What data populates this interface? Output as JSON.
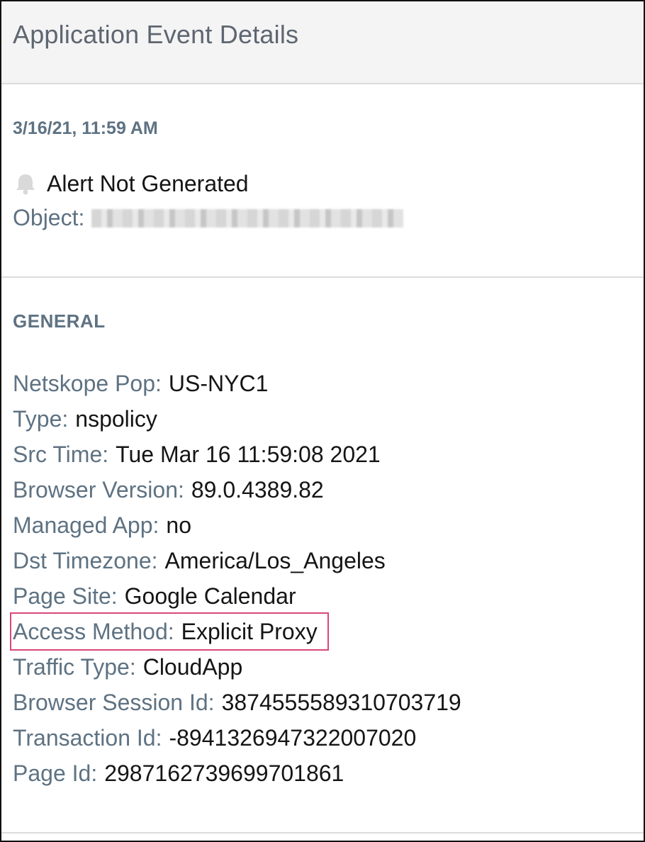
{
  "header": {
    "title": "Application Event Details"
  },
  "event": {
    "timestamp": "3/16/21, 11:59 AM",
    "alert_status": "Alert Not Generated",
    "alert_icon": "bell-icon",
    "object_label": "Object:"
  },
  "general": {
    "heading": "GENERAL",
    "fields": [
      {
        "label": "Netskope Pop:",
        "value": "US-NYC1"
      },
      {
        "label": "Type:",
        "value": "nspolicy"
      },
      {
        "label": "Src Time:",
        "value": "Tue Mar 16 11:59:08 2021"
      },
      {
        "label": "Browser Version:",
        "value": "89.0.4389.82"
      },
      {
        "label": "Managed App:",
        "value": "no"
      },
      {
        "label": "Dst Timezone:",
        "value": "America/Los_Angeles"
      },
      {
        "label": "Page Site:",
        "value": "Google Calendar"
      },
      {
        "label": "Access Method:",
        "value": "Explicit Proxy",
        "highlighted": true
      },
      {
        "label": "Traffic Type:",
        "value": "CloudApp"
      },
      {
        "label": "Browser Session Id:",
        "value": "3874555589310703719"
      },
      {
        "label": "Transaction Id:",
        "value": "-8941326947322007020"
      },
      {
        "label": "Page Id:",
        "value": "2987162739699701861"
      }
    ]
  },
  "colors": {
    "label": "#5e7282",
    "value": "#151515",
    "highlight_border": "#d9477b",
    "header_bg": "#f4f4f4"
  }
}
